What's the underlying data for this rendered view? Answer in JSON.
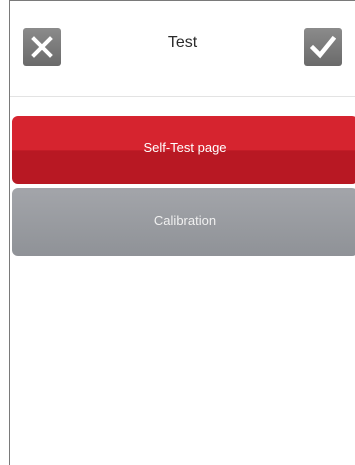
{
  "header": {
    "title": "Test",
    "close_icon": "close-icon",
    "confirm_icon": "checkmark-icon"
  },
  "menu": {
    "items": [
      {
        "label": "Self-Test page",
        "state": "selected",
        "color": "#d6242f"
      },
      {
        "label": "Calibration",
        "state": "normal",
        "color": "#9a9ca1"
      }
    ]
  }
}
